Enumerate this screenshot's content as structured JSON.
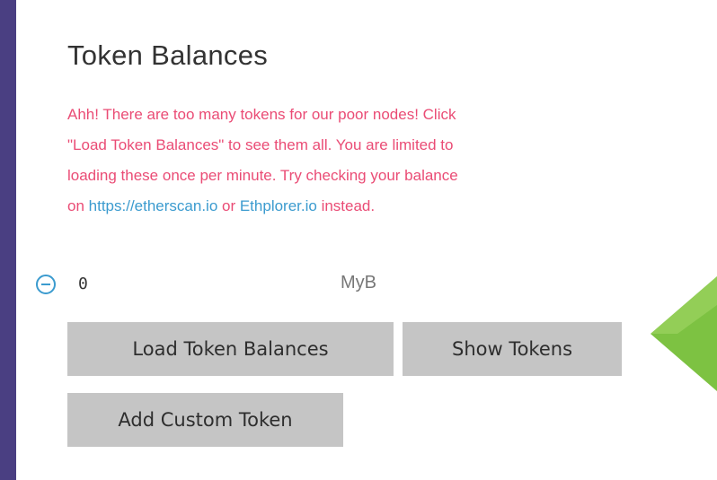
{
  "section": {
    "title": "Token Balances",
    "warning": {
      "line1": "Ahh! There are too many tokens for our poor nodes! Click",
      "line2": "\"Load Token Balances\" to see them all. You are limited to",
      "line3": "loading these once per minute. Try checking your balance",
      "line4_prefix": "on ",
      "link_etherscan": "https://etherscan.io",
      "line4_middle": " or ",
      "link_ethplorer": "Ethplorer.io",
      "line4_suffix": " instead."
    }
  },
  "token": {
    "balance": "0",
    "symbol": "MyB",
    "remove_icon": "minus-circle-icon"
  },
  "buttons": {
    "load_label": "Load Token Balances",
    "show_label": "Show Tokens",
    "add_label": "Add Custom Token"
  },
  "annotation": {
    "icon": "left-arrow-icon",
    "color": "#7dc242"
  },
  "colors": {
    "background": "#4a3f82",
    "warning_text": "#ea4c75",
    "link": "#3b9bcf",
    "button_bg": "#c5c5c5"
  }
}
